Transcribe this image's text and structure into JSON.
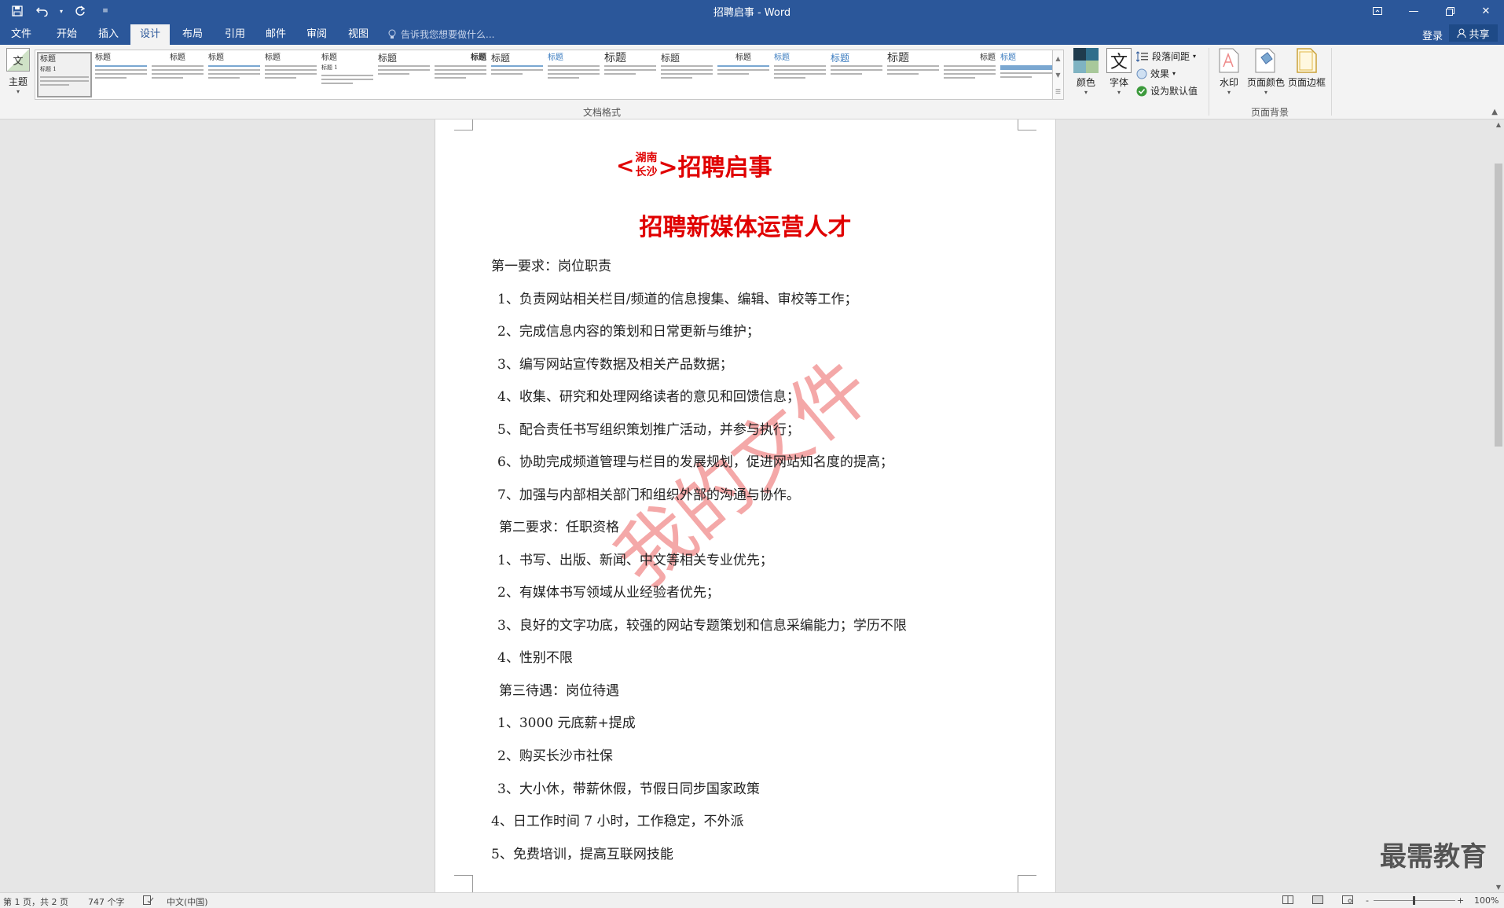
{
  "window": {
    "title": "招聘启事 - Word",
    "qat": [
      "save-icon",
      "undo-icon",
      "undo-dropdown-icon",
      "redo-icon",
      "customize-icon"
    ],
    "controls": [
      "ribbon-display-icon",
      "minimize-icon",
      "restore-icon",
      "close-icon"
    ]
  },
  "tabs": [
    {
      "label": "文件",
      "active": false
    },
    {
      "label": "开始",
      "active": false
    },
    {
      "label": "插入",
      "active": false
    },
    {
      "label": "设计",
      "active": true
    },
    {
      "label": "布局",
      "active": false
    },
    {
      "label": "引用",
      "active": false
    },
    {
      "label": "邮件",
      "active": false
    },
    {
      "label": "审阅",
      "active": false
    },
    {
      "label": "视图",
      "active": false
    }
  ],
  "tellme": "告诉我您想要做什么...",
  "account": {
    "login": "登录",
    "share": "共享"
  },
  "ribbon": {
    "theme_label": "主题",
    "theme_icon_text": "文",
    "styles_thumb_title": "标题",
    "styles_thumb_subtitle": "标题 1",
    "group_doc_format": "文档格式",
    "colors_label": "颜色",
    "fonts_label": "字体",
    "fonts_icon_text": "文",
    "paragraph_spacing": "段落间距",
    "effects": "效果",
    "set_default": "设为默认值",
    "watermark_label": "水印",
    "page_color_label": "页面颜色",
    "page_border_label": "页面边框",
    "group_page_bg": "页面背景"
  },
  "document": {
    "header_left": "<",
    "header_top": "湖南",
    "header_bottom": "长沙",
    "header_right": ">招聘启事",
    "subtitle": "招聘新媒体运营人才",
    "lines": [
      "第一要求：岗位职责",
      "1、负责网站相关栏目/频道的信息搜集、编辑、审校等工作；",
      "2、完成信息内容的策划和日常更新与维护；",
      "3、编写网站宣传数据及相关产品数据；",
      "4、收集、研究和处理网络读者的意见和回馈信息；",
      "5、配合责任书写组织策划推广活动，并参与执行；",
      "6、协助完成频道管理与栏目的发展规划，促进网站知名度的提高；",
      "7、加强与内部相关部门和组织外部的沟通与协作。",
      "第二要求：任职资格",
      "1、书写、出版、新闻、中文等相关专业优先；",
      "2、有媒体书写领域从业经验者优先；",
      "3、良好的文字功底，较强的网站专题策划和信息采编能力；学历不限",
      "4、性别不限",
      "第三待遇：岗位待遇",
      "1、3000 元底薪+提成",
      "2、购买长沙市社保",
      "3、大小休，带薪休假，节假日同步国家政策",
      "4、日工作时间 7 小时，工作稳定，不外派",
      "5、免费培训，提高互联网技能"
    ],
    "watermark": "我的文件",
    "watermark_color": "#f4a8a8",
    "heading_color": "#e00000"
  },
  "brand": "最需教育",
  "status": {
    "page": "第 1 页，共 2 页",
    "words": "747 个字",
    "lang": "中文(中国)",
    "zoom": "100%",
    "zoom_minus": "-",
    "zoom_plus": "+"
  },
  "colors": {
    "accent": "#2b579a"
  }
}
